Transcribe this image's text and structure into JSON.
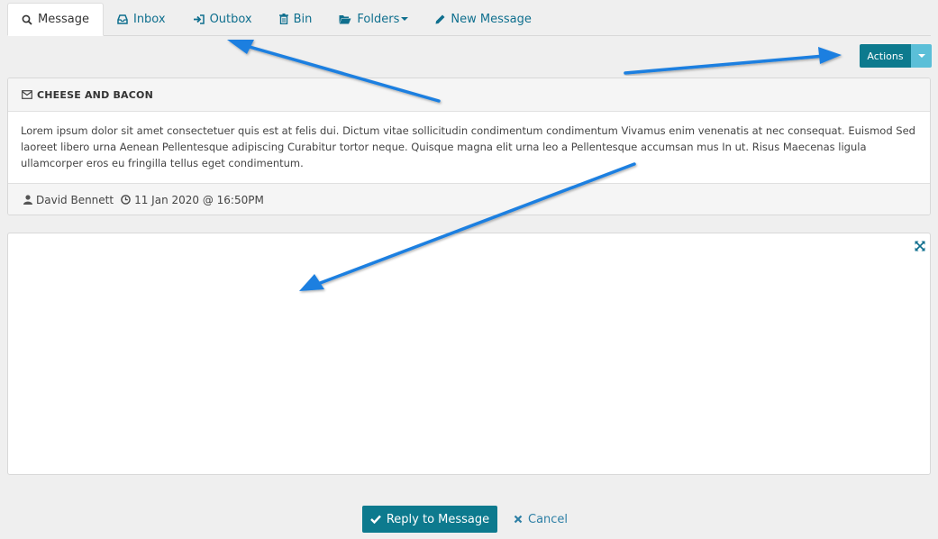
{
  "tabs": [
    {
      "label": "Message",
      "icon": "search-icon",
      "active": true
    },
    {
      "label": "Inbox",
      "icon": "inbox-icon"
    },
    {
      "label": "Outbox",
      "icon": "sign-in-icon"
    },
    {
      "label": "Bin",
      "icon": "trash-icon"
    },
    {
      "label": "Folders",
      "icon": "folder-open-icon"
    },
    {
      "label": "New Message",
      "icon": "pencil-icon"
    }
  ],
  "actions": {
    "label": "Actions"
  },
  "message": {
    "subject": "CHEESE AND BACON",
    "body": "Lorem ipsum dolor sit amet consectetuer quis est at felis dui. Dictum vitae sollicitudin condimentum condimentum Vivamus enim venenatis at nec consequat. Euismod Sed laoreet libero urna Aenean Pellentesque adipiscing Curabitur tortor neque. Quisque magna elit urna leo a Pellentesque accumsan mus In ut. Risus Maecenas ligula ullamcorper eros eu fringilla tellus eget condimentum.",
    "author": "David Bennett",
    "date": "11 Jan 2020 @ 16:50PM"
  },
  "buttons": {
    "reply": "Reply to Message",
    "cancel": "Cancel"
  },
  "colors": {
    "accent": "#0d7a8e",
    "link": "#0f6f8e",
    "arrow": "#1a7fe0"
  }
}
